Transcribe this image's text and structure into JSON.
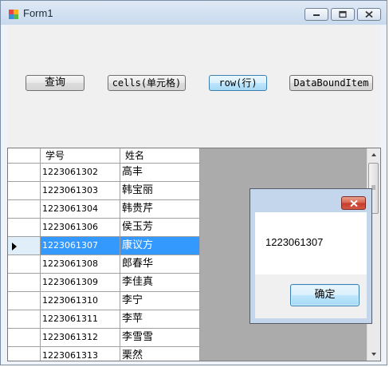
{
  "window": {
    "title": "Form1"
  },
  "toolbar": {
    "query_label": "查询",
    "cells_label": "cells(单元格)",
    "row_label": "row(行)",
    "databound_label": "DataBoundItem"
  },
  "grid": {
    "columns": [
      "学号",
      "姓名"
    ],
    "rows": [
      {
        "id": "1223061302",
        "name": "高丰"
      },
      {
        "id": "1223061303",
        "name": "韩宝丽"
      },
      {
        "id": "1223061304",
        "name": "韩贵芹"
      },
      {
        "id": "1223061306",
        "name": "侯玉芳"
      },
      {
        "id": "1223061307",
        "name": "康议方"
      },
      {
        "id": "1223061308",
        "name": "郎春华"
      },
      {
        "id": "1223061309",
        "name": "李佳真"
      },
      {
        "id": "1223061310",
        "name": "李宁"
      },
      {
        "id": "1223061311",
        "name": "李苹"
      },
      {
        "id": "1223061312",
        "name": "李雪雪"
      },
      {
        "id": "1223061313",
        "name": "栗然"
      }
    ],
    "selected_row": 4
  },
  "messagebox": {
    "text": "1223061307",
    "ok_label": "确定"
  },
  "colors": {
    "selection": "#3399ff",
    "close_button": "#c7392a"
  }
}
